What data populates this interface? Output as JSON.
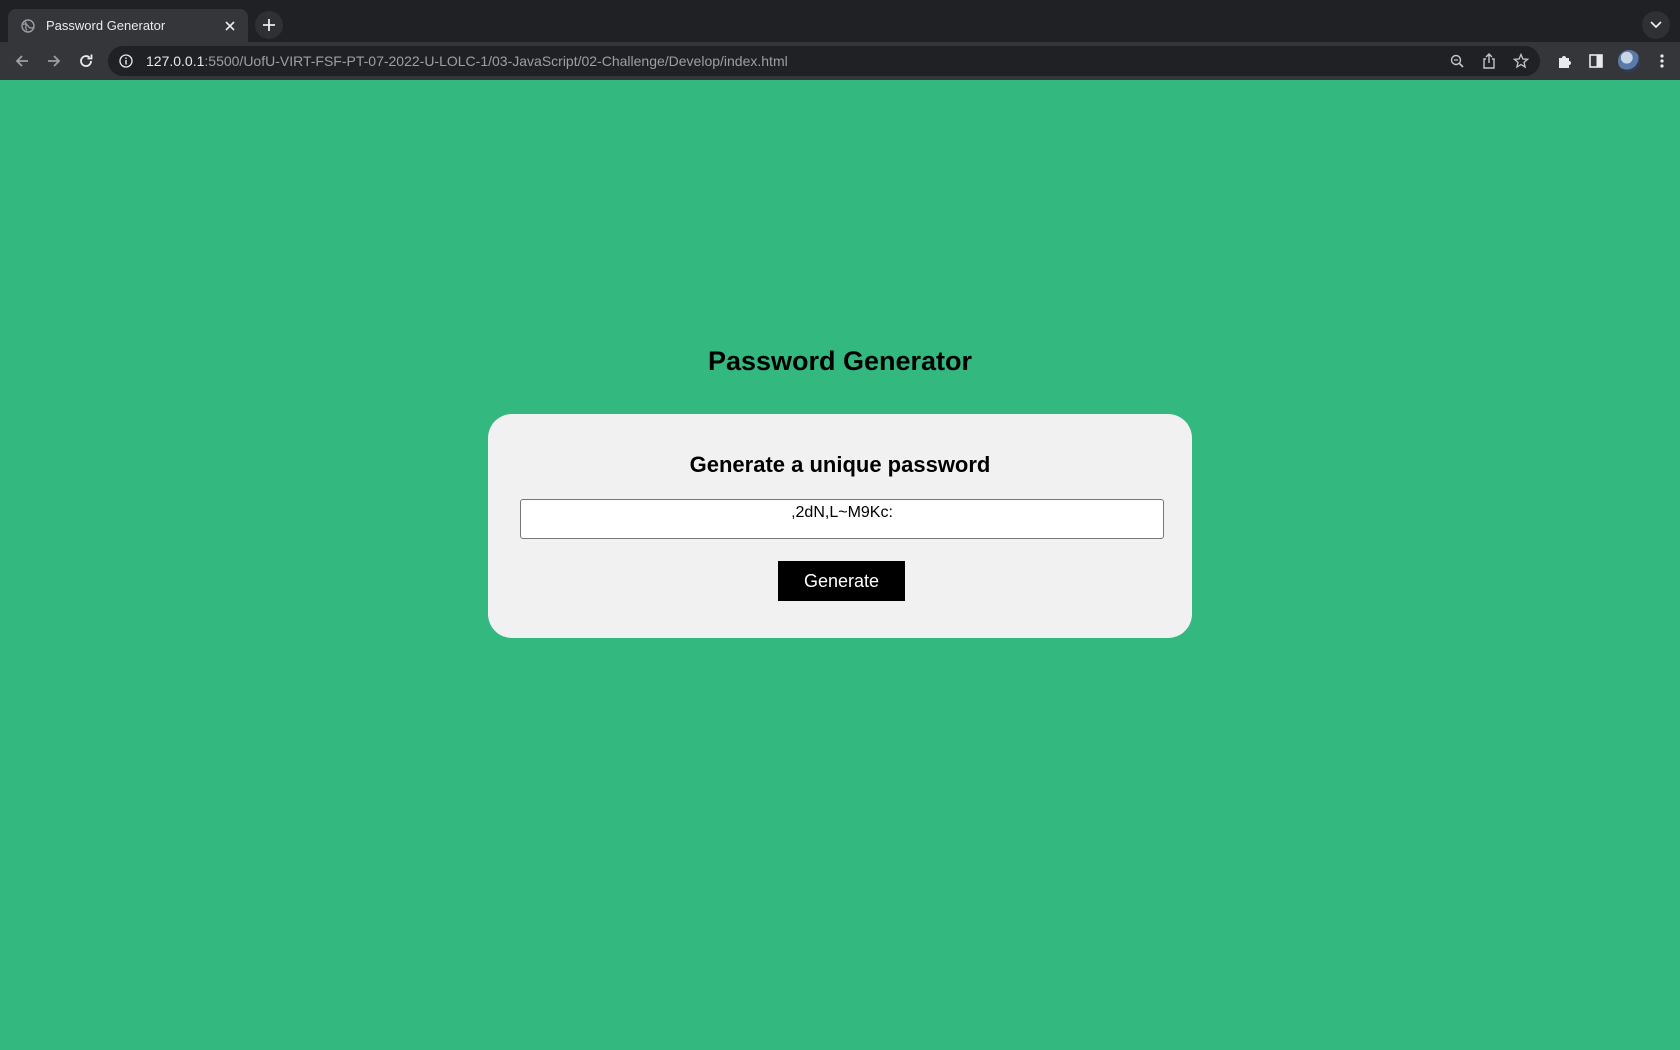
{
  "browser": {
    "tab_title": "Password Generator",
    "url_host": "127.0.0.1",
    "url_rest": ":5500/UofU-VIRT-FSF-PT-07-2022-U-LOLC-1/03-JavaScript/02-Challenge/Develop/index.html",
    "icons": {
      "favicon": "globe-icon",
      "close": "close-icon",
      "new_tab": "plus-icon",
      "back": "back-arrow-icon",
      "forward": "forward-arrow-icon",
      "reload": "reload-icon",
      "info": "info-icon",
      "zoom": "zoom-icon",
      "share": "share-icon",
      "bookmark": "star-icon",
      "extensions": "puzzle-icon",
      "sidepanel": "side-panel-icon",
      "menu": "kebab-menu-icon",
      "tab_search": "chevron-down-icon"
    }
  },
  "page": {
    "title": "Password Generator",
    "card_heading": "Generate a unique password",
    "password_value": ",2dN,L~M9Kc:",
    "generate_label": "Generate"
  },
  "colors": {
    "page_background": "#33b97f",
    "card_background": "#f1f1f1",
    "button_background": "#000000",
    "button_text": "#ffffff"
  }
}
